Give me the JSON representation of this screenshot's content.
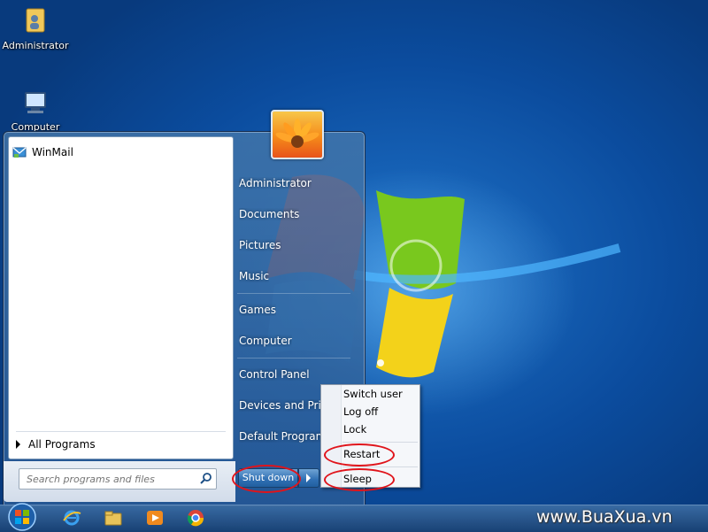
{
  "desktop": {
    "icons": [
      {
        "label": "Administrator",
        "icon": "user-folder-icon"
      },
      {
        "label": "Computer",
        "icon": "computer-icon"
      }
    ]
  },
  "start_menu": {
    "pinned": [
      {
        "label": "WinMail",
        "icon": "winmail-icon"
      }
    ],
    "all_programs": "All Programs",
    "search_placeholder": "Search programs and files",
    "right_pane": [
      "Administrator",
      "Documents",
      "Pictures",
      "Music",
      "Games",
      "Computer",
      "Control Panel",
      "Devices and Printers",
      "Default Programs"
    ],
    "shutdown_label": "Shut down"
  },
  "power_menu": {
    "items": [
      "Switch user",
      "Log off",
      "Lock",
      "Restart",
      "Sleep"
    ],
    "highlighted": [
      "Shut down",
      "Restart",
      "Sleep"
    ],
    "highlight_color": "#e0141b"
  },
  "taskbar": {
    "icons": [
      "start-orb-icon",
      "internet-explorer-icon",
      "file-explorer-icon",
      "media-player-icon",
      "chrome-icon"
    ]
  },
  "watermark": "www.BuaXua.vn"
}
